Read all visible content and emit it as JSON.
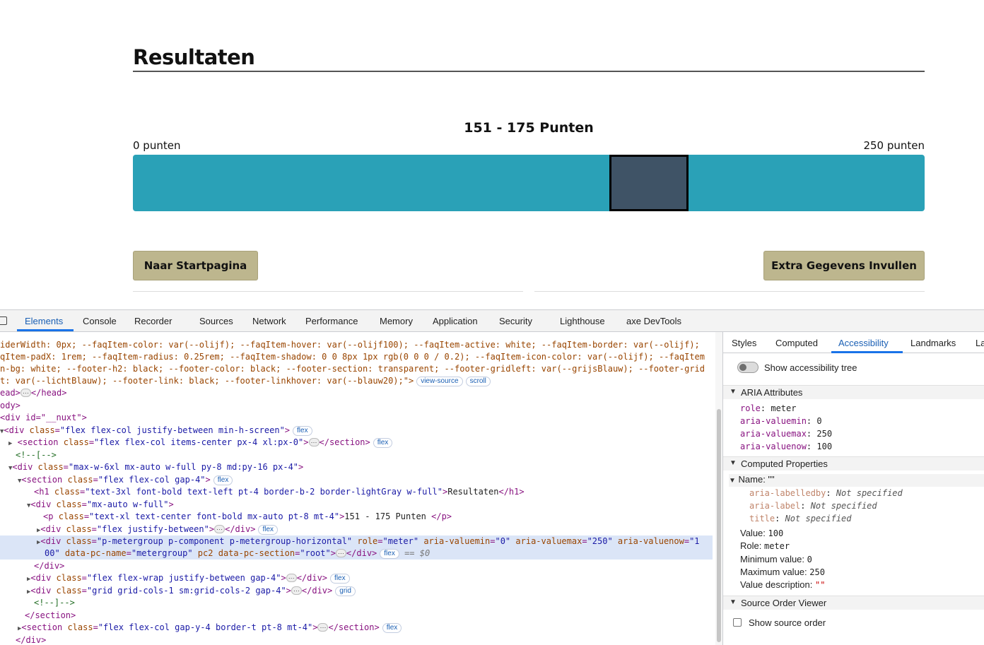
{
  "page": {
    "title": "Resultaten",
    "score_label": "151 - 175 Punten",
    "range_min_label": "0 punten",
    "range_max_label": "250 punten",
    "meter": {
      "min": 0,
      "max": 250,
      "value": 100,
      "color": "#2aa1b7",
      "marker_color": "#3f5366"
    },
    "buttons": {
      "start": "Naar Startpagina",
      "extra": "Extra Gegevens Invullen"
    },
    "button_color": "#bdb68e"
  },
  "devtools": {
    "tabs": [
      "Elements",
      "Console",
      "Recorder",
      "Sources",
      "Network",
      "Performance",
      "Memory",
      "Application",
      "Security",
      "Lighthouse",
      "axe DevTools"
    ],
    "active_tab": "Elements",
    "elements": {
      "l0": "iderWidth: 0px; --faqItem-color: var(--olijf); --faqItem-hover: var(--olijf100); --faqItem-active: white; --faqItem-border: var(--olijf);",
      "l1": "qItem-padX: 1rem; --faqItem-radius: 0.25rem; --faqItem-shadow: 0 0 8px 1px rgb(0 0 0 / 0.2); --faqItem-icon-color: var(--olijf); --faqItem",
      "l2": "n-bg: white; --footer-h2: black; --footer-color: black; --footer-section: transparent; --footer-gridleft: var(--grijsBlauw); --footer-grid",
      "l3": "t: var(--lichtBlauw); --footer-link: black; --footer-linkhover: var(--blauw20);\">",
      "pill_view_source": "view-source",
      "pill_scroll": "scroll",
      "head_close": "ead>",
      "head_end": "</head>",
      "body": "ody>",
      "nuxt": "<div id=\"__nuxt\">",
      "div1_open": "<div ",
      "div1_attr": "class",
      "div1_val": "\"flex flex-col justify-between min-h-screen\"",
      "section1_val": "\"flex flex-col items-center px-4 xl:px-0\"",
      "comment1": "<!--[-->",
      "div2_val": "\"max-w-6xl mx-auto w-full py-8 md:py-16 px-4\"",
      "section2_val": "\"flex flex-col gap-4\"",
      "h1_val": "\"text-3xl font-bold text-left pt-4 border-b-2 border-lightGray w-full\"",
      "h1_text": "Resultaten",
      "div3_val": "\"mx-auto w-full\"",
      "p_val": "\"text-xl text-center font-bold mx-auto pt-8 mt-4\"",
      "p_text": "151 - 175 Punten ",
      "div4_val": "\"flex justify-between\"",
      "div5_val": "\"p-metergroup p-component p-metergroup-horizontal\"",
      "div5_role": "\"meter\"",
      "div5_min": "\"0\"",
      "div5_max": "\"250\"",
      "div5_now_a": "\"1",
      "div5_now_b": "00\"",
      "div5_pcname": "\"metergroup\"",
      "div5_pc2": "pc2",
      "div5_section": "\"root\"",
      "sel_marker": "== $0",
      "div_close": "</div>",
      "div6_val": "\"flex flex-wrap justify-between gap-4\"",
      "div7_val": "\"grid grid-cols-1 sm:grid-cols-2 gap-4\"",
      "comment2": "<!--]-->",
      "section_close": "</section>",
      "section3_val": "\"flex flex-col gap-y-4 border-t pt-8 mt-4\"",
      "pill_flex": "flex",
      "pill_grid": "grid"
    },
    "sidebar": {
      "tabs": [
        "Styles",
        "Computed",
        "Accessibility",
        "Landmarks",
        "La"
      ],
      "active_tab": "Accessibility",
      "show_tree_label": "Show accessibility tree",
      "aria_header": "ARIA Attributes",
      "aria": [
        {
          "key": "role",
          "value": "meter"
        },
        {
          "key": "aria-valuemin",
          "value": "0"
        },
        {
          "key": "aria-valuemax",
          "value": "250"
        },
        {
          "key": "aria-valuenow",
          "value": "100"
        }
      ],
      "computed_header": "Computed Properties",
      "name_label": "Name: \"\"",
      "name_sources": [
        {
          "key": "aria-labelledby",
          "value": "Not specified"
        },
        {
          "key": "aria-label",
          "value": "Not specified"
        },
        {
          "key": "title",
          "value": "Not specified"
        }
      ],
      "computed": [
        {
          "key": "Value",
          "value": "100"
        },
        {
          "key": "Role",
          "value": "meter"
        },
        {
          "key": "Minimum value",
          "value": "0"
        },
        {
          "key": "Maximum value",
          "value": "250"
        },
        {
          "key": "Value description",
          "value": "\"\""
        }
      ],
      "source_order_header": "Source Order Viewer",
      "show_source_order_label": "Show source order"
    }
  }
}
